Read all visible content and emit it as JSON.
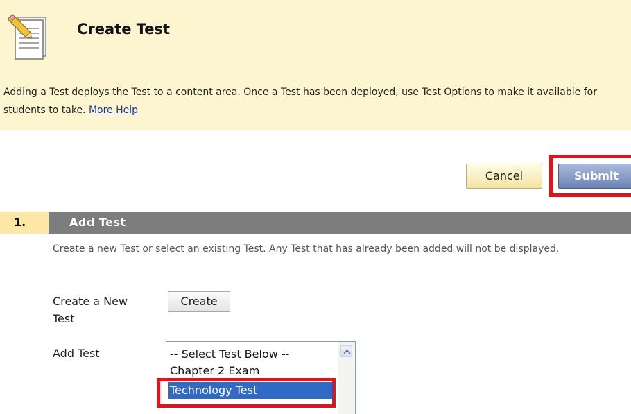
{
  "header": {
    "title": "Create Test",
    "icon": "document-pencil-icon",
    "description": "Adding a Test deploys the Test to a content area. Once a Test has been deployed, use Test Options to make it available for students to take.",
    "help_link": "More Help"
  },
  "actions": {
    "cancel_label": "Cancel",
    "submit_label": "Submit"
  },
  "section": {
    "number": "1.",
    "title": "Add Test",
    "description": "Create a new Test or select an existing Test. Any Test that has already been added will not be displayed.",
    "create_label": "Create a New Test",
    "create_button": "Create",
    "add_label": "Add Test",
    "options": [
      "-- Select Test Below --",
      "Chapter 2 Exam",
      "Technology Test"
    ],
    "selected_option": "Technology Test"
  },
  "colors": {
    "banner_bg": "#fcf5cf",
    "section_bar": "#7d7d7d",
    "submit_bg": "#6d84b4",
    "highlight": "#e0141c",
    "selected_option_bg": "#316ac5"
  }
}
